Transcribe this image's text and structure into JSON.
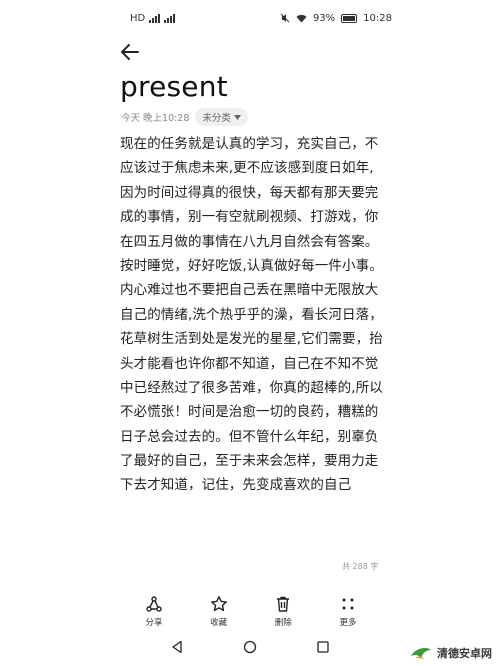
{
  "status_bar": {
    "left_icons": "HD",
    "battery": "93%",
    "time": "10:28"
  },
  "note": {
    "title": "present",
    "date": "今天 晚上10:28",
    "category": "未分类",
    "lines": [
      "现在的任务就是认真的学习，充实自己，不",
      "应该过于焦虑未来,更不应该感到度日如年,",
      "因为时间过得真的很快，每天都有那天要完",
      "成的事情，别一有空就刷视频、打游戏，你",
      "在四五月做的事情在八九月自然会有答案。",
      "按时睡觉，好好吃饭,认真做好每一件小事。",
      "内心难过也不要把自己丢在黑暗中无限放大",
      "自己的情绪,洗个热乎乎的澡，看长河日落，",
      "花草树生活到处是发光的星星,它们需要，抬",
      "头才能看也许你都不知道，自己在不知不觉",
      "中已经熬过了很多苦难，你真的超棒的,所以",
      "不必慌张！时间是治愈一切的良药，糟糕的",
      "日子总会过去的。但不管什么年纪，别辜负",
      "了最好的自己，至于未来会怎样，要用力走",
      "下去才知道，记住，先变成喜欢的自己"
    ],
    "char_count": "共 288 字"
  },
  "toolbar": {
    "share": "分享",
    "favorite": "收藏",
    "delete": "删除",
    "more": "更多"
  },
  "watermark": "清德安卓网"
}
